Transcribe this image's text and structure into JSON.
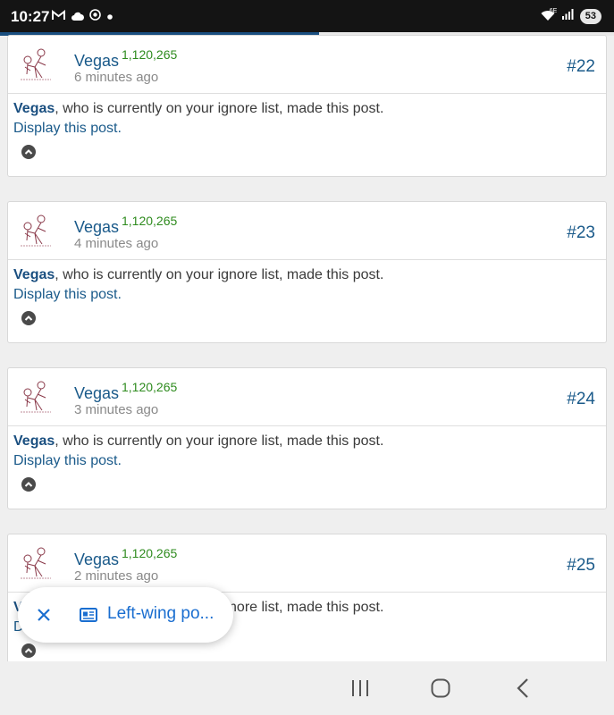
{
  "status_bar": {
    "time": "10:27",
    "left_icons": [
      "gmail-icon",
      "cloud-icon",
      "chrome-icon",
      "notification-dot-icon"
    ],
    "right_icons": [
      "wifi-6e-icon",
      "signal-icon",
      "battery-icon"
    ],
    "wifi_tag": "6E",
    "battery": "53"
  },
  "page_progress": 0.52,
  "posts": [
    {
      "username": "Vegas",
      "post_count": "1,120,265",
      "time_ago": "6 minutes ago",
      "post_number": "#22",
      "ignored_user": "Vegas",
      "ignore_text": ", who is currently on your ignore list, made this post.",
      "display_link": "Display this post."
    },
    {
      "username": "Vegas",
      "post_count": "1,120,265",
      "time_ago": "4 minutes ago",
      "post_number": "#23",
      "ignored_user": "Vegas",
      "ignore_text": ", who is currently on your ignore list, made this post.",
      "display_link": "Display this post."
    },
    {
      "username": "Vegas",
      "post_count": "1,120,265",
      "time_ago": "3 minutes ago",
      "post_number": "#24",
      "ignored_user": "Vegas",
      "ignore_text": ", who is currently on your ignore list, made this post.",
      "display_link": "Display this post."
    },
    {
      "username": "Vegas",
      "post_count": "1,120,265",
      "time_ago": "2 minutes ago",
      "post_number": "#25",
      "ignored_user": "Vegas",
      "ignore_text": ", who is currently on your ignore list, made this post.",
      "display_link": "Display this post."
    }
  ],
  "popup": {
    "close_icon": "close-icon",
    "article_icon": "article-icon",
    "label": "Left-wing po..."
  },
  "nav_bar": {
    "icons": [
      "recent-apps-icon",
      "home-icon",
      "back-icon"
    ]
  },
  "colors": {
    "link": "#1a5a8a",
    "post_count": "#2e8b1e",
    "popup_accent": "#1a6ed0",
    "status_bar": "#141414"
  }
}
